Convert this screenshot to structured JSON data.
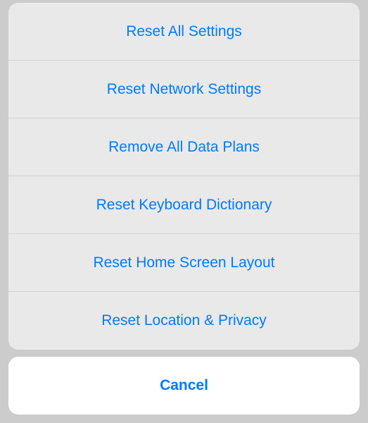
{
  "actionSheet": {
    "options": [
      {
        "label": "Reset All Settings"
      },
      {
        "label": "Reset Network Settings"
      },
      {
        "label": "Remove All Data Plans"
      },
      {
        "label": "Reset Keyboard Dictionary"
      },
      {
        "label": "Reset Home Screen Layout"
      },
      {
        "label": "Reset Location & Privacy"
      }
    ],
    "cancelLabel": "Cancel"
  },
  "colors": {
    "tint": "#007AFF",
    "sheetBackground": "#e9e9ea",
    "cancelBackground": "#ffffff"
  }
}
